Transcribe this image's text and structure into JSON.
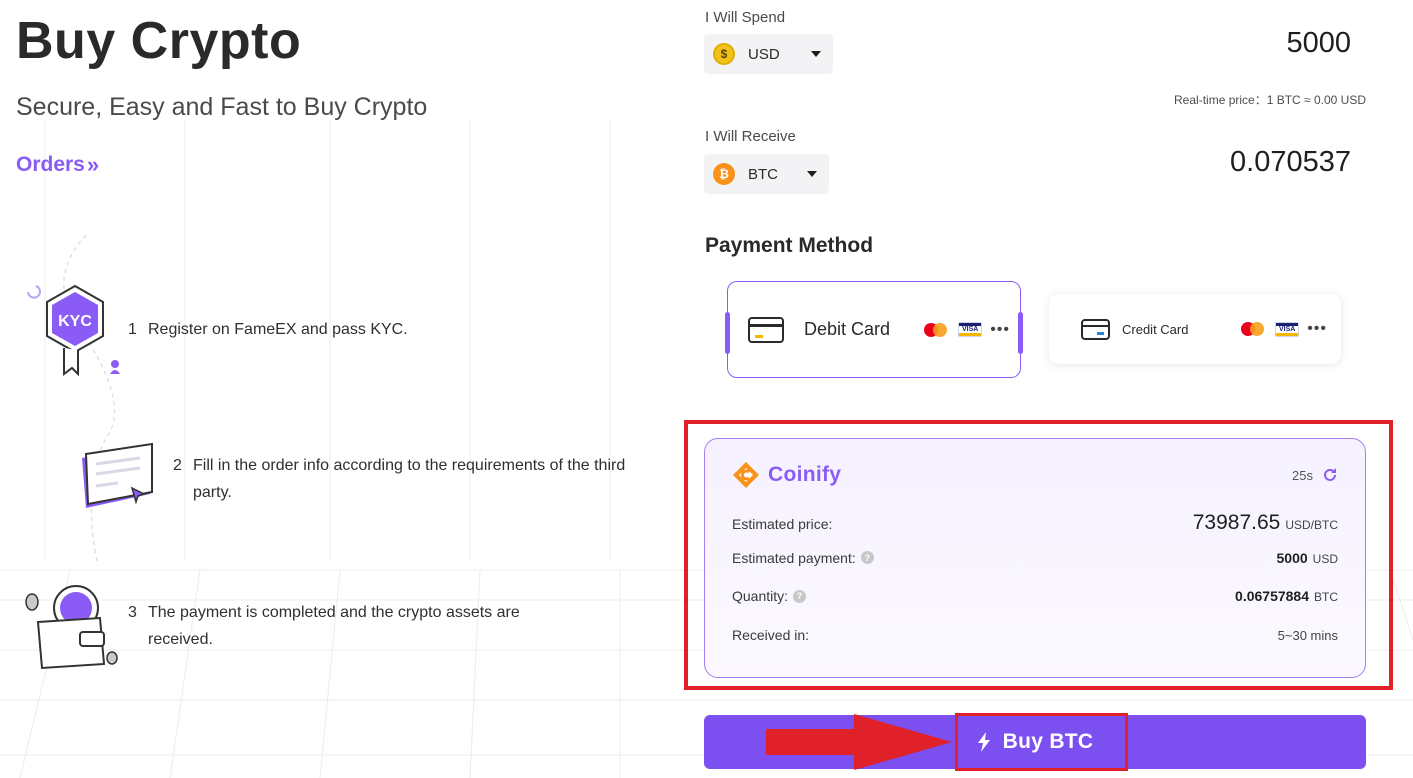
{
  "header": {
    "title": "Buy Crypto",
    "subtitle": "Secure, Easy and Fast to Buy Crypto",
    "orders_label": "Orders",
    "orders_icon": "double-chevron-right-icon"
  },
  "steps": [
    {
      "number": "1",
      "text": "Register on FameEX and pass KYC.",
      "icon": "kyc-badge-icon",
      "badge_text": "KYC"
    },
    {
      "number": "2",
      "text": "Fill in the order info according to the requirements of the third party.",
      "icon": "order-form-icon"
    },
    {
      "number": "3",
      "text": "The payment is completed and the crypto assets are received.",
      "icon": "wallet-icon"
    }
  ],
  "spend": {
    "label": "I Will Spend",
    "currency": "USD",
    "currency_icon": "usd-coin-icon",
    "icon_glyph": "$",
    "amount": "5000"
  },
  "realtime_price": "Real-time price：1 BTC ≈ 0.00 USD",
  "receive": {
    "label": "I Will Receive",
    "currency": "BTC",
    "currency_icon": "btc-coin-icon",
    "icon_glyph": "₿",
    "amount": "0.070537"
  },
  "payment_method": {
    "title": "Payment Method",
    "options": [
      {
        "label": "Debit Card",
        "selected": true,
        "icons": [
          "card-icon",
          "mastercard-icon",
          "visa-icon",
          "more-icon"
        ]
      },
      {
        "label": "Credit Card",
        "selected": false,
        "icons": [
          "card-icon",
          "mastercard-icon",
          "visa-icon",
          "more-icon"
        ]
      }
    ],
    "visa_text": "VISA",
    "more_text": "•••"
  },
  "provider": {
    "name": "Coinify",
    "countdown": "25s",
    "rows": [
      {
        "label": "Estimated price:",
        "value": "73987.65",
        "unit": "USD/BTC",
        "help": false
      },
      {
        "label": "Estimated payment:",
        "value": "5000",
        "unit": "USD",
        "help": true
      },
      {
        "label": "Quantity:",
        "value": "0.06757884",
        "unit": "BTC",
        "help": true
      },
      {
        "label": "Received in:",
        "value": "5~30 mins",
        "unit": "",
        "help": false
      }
    ],
    "help_glyph": "?"
  },
  "buy_button": {
    "label": "Buy BTC",
    "icon": "lightning-icon"
  },
  "colors": {
    "accent": "#8a5cf5",
    "button": "#7b4ff0",
    "annotation_red": "#e0212a",
    "coinify_orange": "#f7931a"
  }
}
